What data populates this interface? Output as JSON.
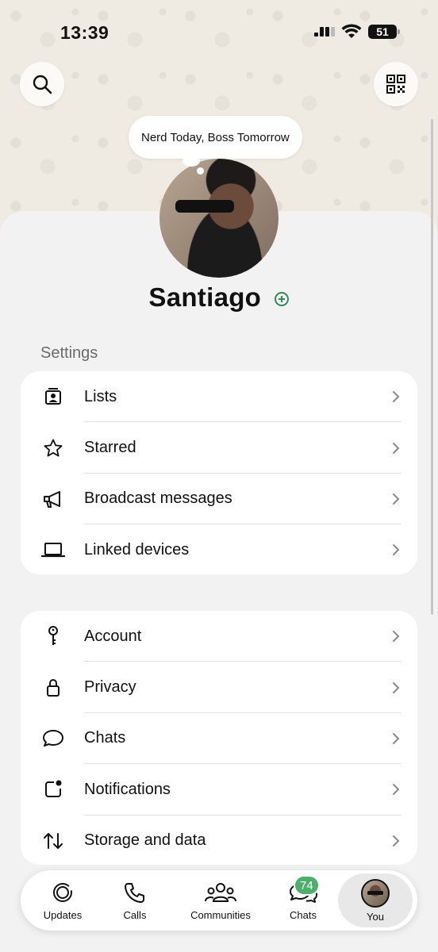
{
  "status_bar": {
    "time": "13:39",
    "battery": "51"
  },
  "profile": {
    "bubble_text": "Nerd Today, Boss Tomorrow",
    "name": "Santiago"
  },
  "settings": {
    "section_title": "Settings",
    "group1": [
      {
        "label": "Lists",
        "icon": "list-card-icon"
      },
      {
        "label": "Starred",
        "icon": "star-icon"
      },
      {
        "label": "Broadcast messages",
        "icon": "megaphone-icon"
      },
      {
        "label": "Linked devices",
        "icon": "laptop-icon"
      }
    ],
    "group2": [
      {
        "label": "Account",
        "icon": "key-icon"
      },
      {
        "label": "Privacy",
        "icon": "lock-icon"
      },
      {
        "label": "Chats",
        "icon": "chat-bubble-icon"
      },
      {
        "label": "Notifications",
        "icon": "notification-icon"
      },
      {
        "label": "Storage and data",
        "icon": "arrows-up-down-icon"
      }
    ]
  },
  "tabbar": {
    "updates": "Updates",
    "calls": "Calls",
    "communities": "Communities",
    "chats": "Chats",
    "chats_badge": "74",
    "you": "You"
  },
  "colors": {
    "accent": "#4caf6a",
    "background": "#f2f2f2",
    "card": "#ffffff"
  }
}
